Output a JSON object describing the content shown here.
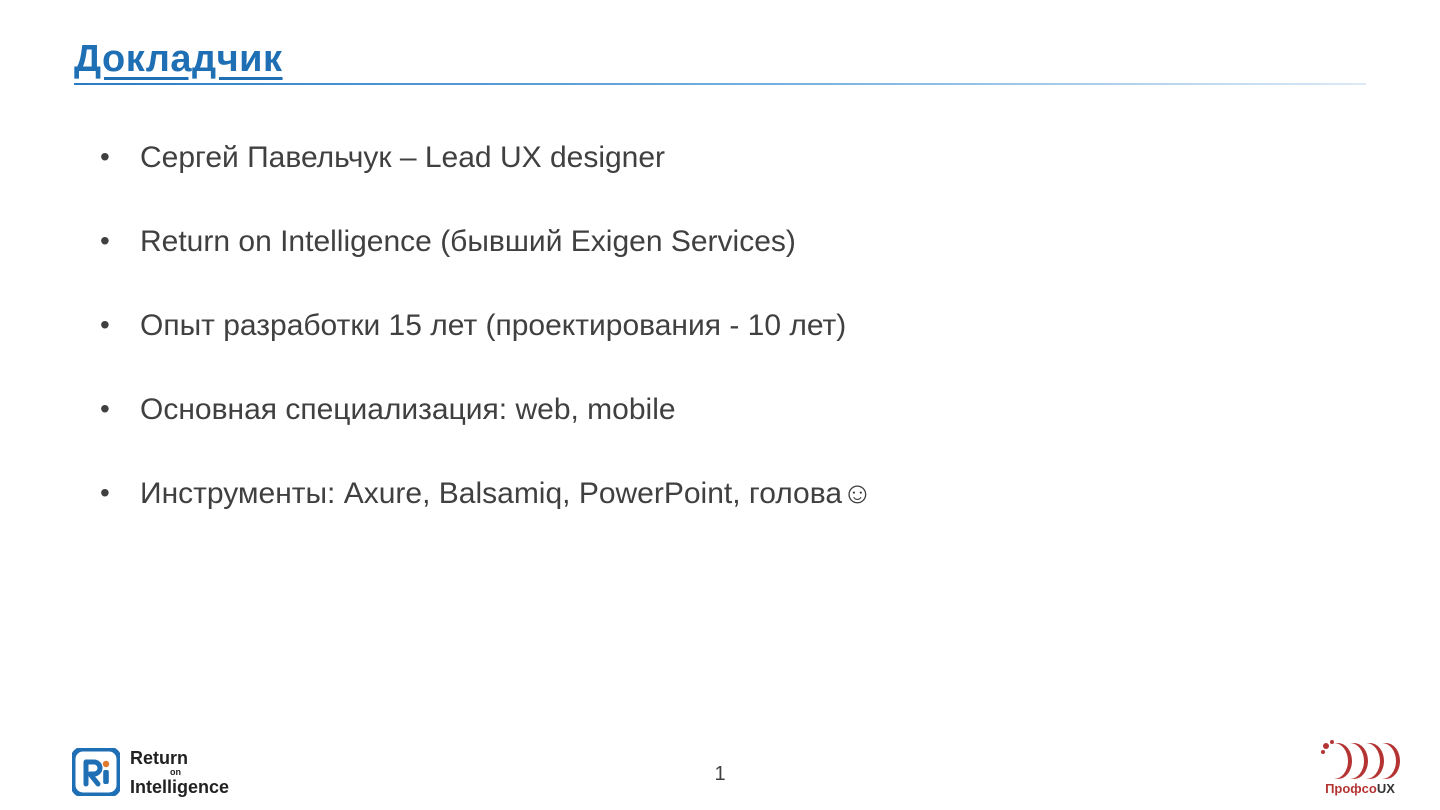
{
  "title": "Докладчик",
  "bullets": [
    "Сергей Павельчук – Lead UX designer",
    "Return on Intelligence (бывший Exigen Services)",
    "Опыт разработки 15 лет (проектирования - 10 лет)",
    "Основная специализация: web, mobile",
    "Инструменты: Axure, Balsamiq, PowerPoint, голова☺"
  ],
  "page_number": "1",
  "logos": {
    "left": {
      "line1": "Return",
      "line2": "on",
      "line3": "Intelligence"
    },
    "right": {
      "name": "Профсо",
      "suffix": "UX"
    }
  }
}
